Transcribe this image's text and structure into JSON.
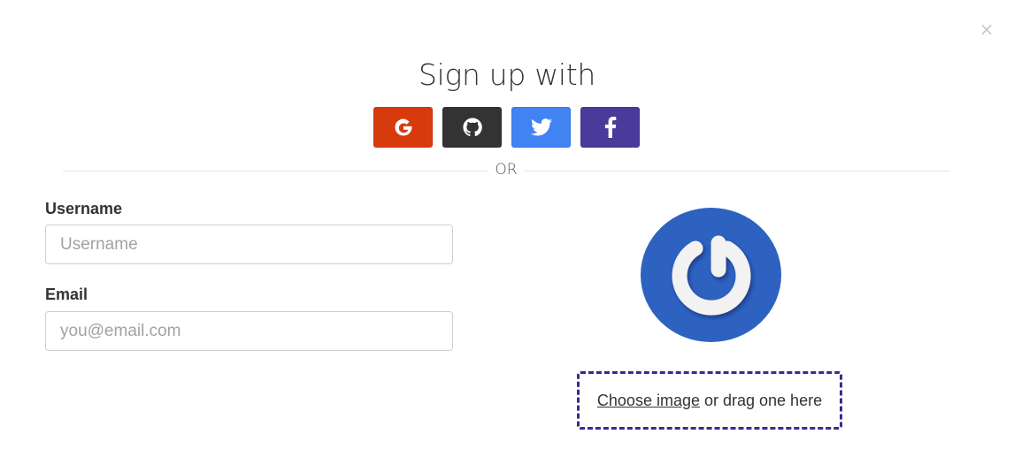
{
  "modal": {
    "close_label": "×",
    "title": "Sign up with",
    "divider_label": "OR"
  },
  "social": [
    {
      "name": "google",
      "icon": "google-icon",
      "color": "#d73b0d"
    },
    {
      "name": "github",
      "icon": "github-icon",
      "color": "#333333"
    },
    {
      "name": "twitter",
      "icon": "twitter-icon",
      "color": "#4183f3"
    },
    {
      "name": "facebook",
      "icon": "facebook-icon",
      "color": "#4a3a9a"
    }
  ],
  "form": {
    "username": {
      "label": "Username",
      "placeholder": "Username",
      "value": ""
    },
    "email": {
      "label": "Email",
      "placeholder": "you@email.com",
      "value": ""
    }
  },
  "avatar": {
    "icon": "power-logo-icon",
    "background": "#2d62c1"
  },
  "dropzone": {
    "link_text": "Choose image",
    "rest_text": " or drag one here",
    "border_color": "#3a2a8f"
  }
}
